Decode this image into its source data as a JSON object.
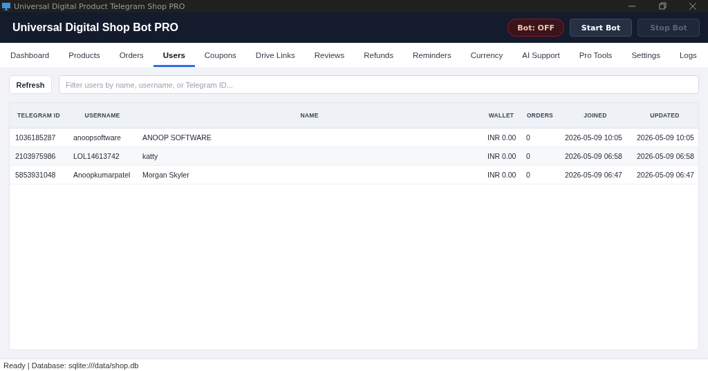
{
  "window": {
    "title": "Universal Digital Product Telegram Shop PRO"
  },
  "header": {
    "title": "Universal Digital Shop Bot PRO",
    "bot_status": {
      "label": "Bot: OFF",
      "on": false
    },
    "buttons": [
      {
        "label": "Start Bot",
        "disabled": false
      },
      {
        "label": "Stop Bot",
        "disabled": true
      }
    ]
  },
  "tabs": [
    {
      "label": "Dashboard",
      "selected": false
    },
    {
      "label": "Products",
      "selected": false
    },
    {
      "label": "Orders",
      "selected": false
    },
    {
      "label": "Users",
      "selected": true
    },
    {
      "label": "Coupons",
      "selected": false
    },
    {
      "label": "Drive Links",
      "selected": false
    },
    {
      "label": "Reviews",
      "selected": false
    },
    {
      "label": "Refunds",
      "selected": false
    },
    {
      "label": "Reminders",
      "selected": false
    },
    {
      "label": "Currency",
      "selected": false
    },
    {
      "label": "AI Support",
      "selected": false
    },
    {
      "label": "Pro Tools",
      "selected": false
    },
    {
      "label": "Settings",
      "selected": false
    },
    {
      "label": "Logs",
      "selected": false
    }
  ],
  "toolbar": {
    "refresh_button": "Refresh",
    "search": {
      "placeholder": "Filter users by name, username, or Telegram ID..."
    }
  },
  "table": {
    "columns": [
      "TELEGRAM ID",
      "USERNAME",
      "NAME",
      "WALLET",
      "ORDERS",
      "JOINED",
      "UPDATED"
    ],
    "rows": [
      [
        "1036185287",
        "anoopsoftware",
        "ANOOP SOFTWARE",
        "INR 0.00",
        "0",
        "2026-05-09 10:05",
        "2026-05-09 10:05"
      ],
      [
        "2103975986",
        "LOL14613742",
        "katty",
        "INR 0.00",
        "0",
        "2026-05-09 06:58",
        "2026-05-09 06:58"
      ],
      [
        "5853931048",
        "Anoopkumarpatel",
        "Morgan Skyler",
        "INR 0.00",
        "0",
        "2026-05-09 06:47",
        "2026-05-09 06:47"
      ]
    ]
  },
  "status_bar": "Ready | Database: sqlite:///data/shop.db"
}
